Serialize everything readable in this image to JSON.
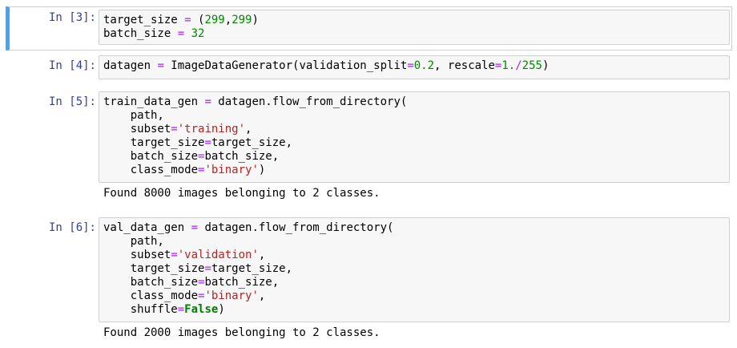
{
  "cells": [
    {
      "prompt": "In [3]:",
      "lines": [
        [
          [
            "",
            "target_size "
          ],
          [
            "op",
            "="
          ],
          [
            "",
            " ("
          ],
          [
            "num",
            "299"
          ],
          [
            "",
            ","
          ],
          [
            "num",
            "299"
          ],
          [
            "",
            ")"
          ]
        ],
        [
          [
            "",
            "batch_size "
          ],
          [
            "op",
            "="
          ],
          [
            "",
            " "
          ],
          [
            "num",
            "32"
          ]
        ]
      ],
      "output": ""
    },
    {
      "prompt": "In [4]:",
      "lines": [
        [
          [
            "",
            "datagen "
          ],
          [
            "op",
            "="
          ],
          [
            "",
            " ImageDataGenerator(validation_split"
          ],
          [
            "op",
            "="
          ],
          [
            "num",
            "0.2"
          ],
          [
            "",
            ", rescale"
          ],
          [
            "op",
            "="
          ],
          [
            "num",
            "1."
          ],
          [
            "op",
            "/"
          ],
          [
            "num",
            "255"
          ],
          [
            "",
            ")"
          ]
        ]
      ],
      "output": ""
    },
    {
      "prompt": "In [5]:",
      "lines": [
        [
          [
            "",
            "train_data_gen "
          ],
          [
            "op",
            "="
          ],
          [
            "",
            " datagen.flow_from_directory("
          ]
        ],
        [
          [
            "",
            "    path,"
          ]
        ],
        [
          [
            "",
            "    subset"
          ],
          [
            "op",
            "="
          ],
          [
            "str",
            "'training'"
          ],
          [
            "",
            ","
          ]
        ],
        [
          [
            "",
            "    target_size"
          ],
          [
            "op",
            "="
          ],
          [
            "",
            "target_size,"
          ]
        ],
        [
          [
            "",
            "    batch_size"
          ],
          [
            "op",
            "="
          ],
          [
            "",
            "batch_size,"
          ]
        ],
        [
          [
            "",
            "    class_mode"
          ],
          [
            "op",
            "="
          ],
          [
            "str",
            "'binary'"
          ],
          [
            "",
            ")"
          ]
        ]
      ],
      "output": "Found 8000 images belonging to 2 classes."
    },
    {
      "prompt": "In [6]:",
      "lines": [
        [
          [
            "",
            "val_data_gen "
          ],
          [
            "op",
            "="
          ],
          [
            "",
            " datagen.flow_from_directory("
          ]
        ],
        [
          [
            "",
            "    path,"
          ]
        ],
        [
          [
            "",
            "    subset"
          ],
          [
            "op",
            "="
          ],
          [
            "str",
            "'validation'"
          ],
          [
            "",
            ","
          ]
        ],
        [
          [
            "",
            "    target_size"
          ],
          [
            "op",
            "="
          ],
          [
            "",
            "target_size,"
          ]
        ],
        [
          [
            "",
            "    batch_size"
          ],
          [
            "op",
            "="
          ],
          [
            "",
            "batch_size,"
          ]
        ],
        [
          [
            "",
            "    class_mode"
          ],
          [
            "op",
            "="
          ],
          [
            "str",
            "'binary'"
          ],
          [
            "",
            ","
          ]
        ],
        [
          [
            "",
            "    shuffle"
          ],
          [
            "op",
            "="
          ],
          [
            "kw",
            "False"
          ],
          [
            "",
            ")"
          ]
        ]
      ],
      "output": "Found 2000 images belonging to 2 classes."
    }
  ],
  "colors": {
    "prompt": "#303f9f",
    "operator": "#aa22ff",
    "number": "#008800",
    "string": "#ba2121",
    "keyword": "#008000",
    "selected_bar": "#42a5f5",
    "input_bg": "#f7f7f7"
  }
}
